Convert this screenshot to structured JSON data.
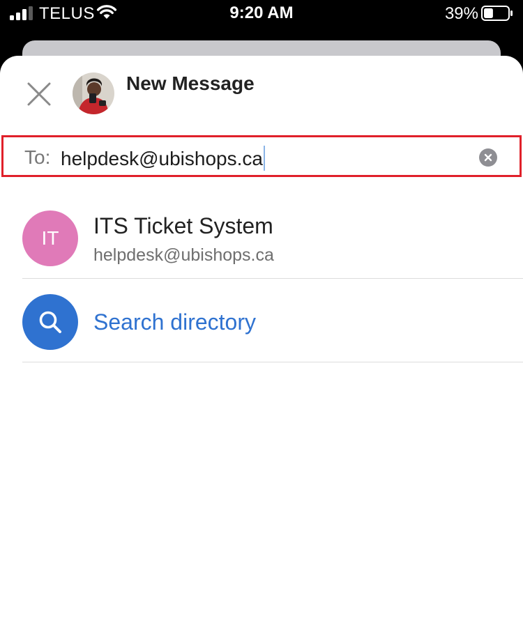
{
  "status_bar": {
    "carrier": "TELUS",
    "time": "9:20 AM",
    "battery_percent": "39%",
    "battery_level": 0.39,
    "signal_bars": 3,
    "signal_icon": "signal-icon",
    "wifi_icon": "wifi-icon",
    "battery_icon": "battery-icon"
  },
  "header": {
    "title": "New Message",
    "close_icon": "close-icon",
    "avatar": "profile-avatar"
  },
  "to_field": {
    "label": "To:",
    "value": "helpdesk@ubishops.ca",
    "clear_icon": "clear-icon"
  },
  "suggestions": [
    {
      "initials": "IT",
      "name": "ITS Ticket System",
      "email": "helpdesk@ubishops.ca",
      "avatar_color": "#e07ab8"
    },
    {
      "label": "Search directory",
      "icon": "search-icon",
      "icon_bg": "#2f72d0",
      "label_color": "#2f72d0"
    }
  ],
  "colors": {
    "highlight_border": "#e0202a",
    "accent": "#2f72d0"
  }
}
